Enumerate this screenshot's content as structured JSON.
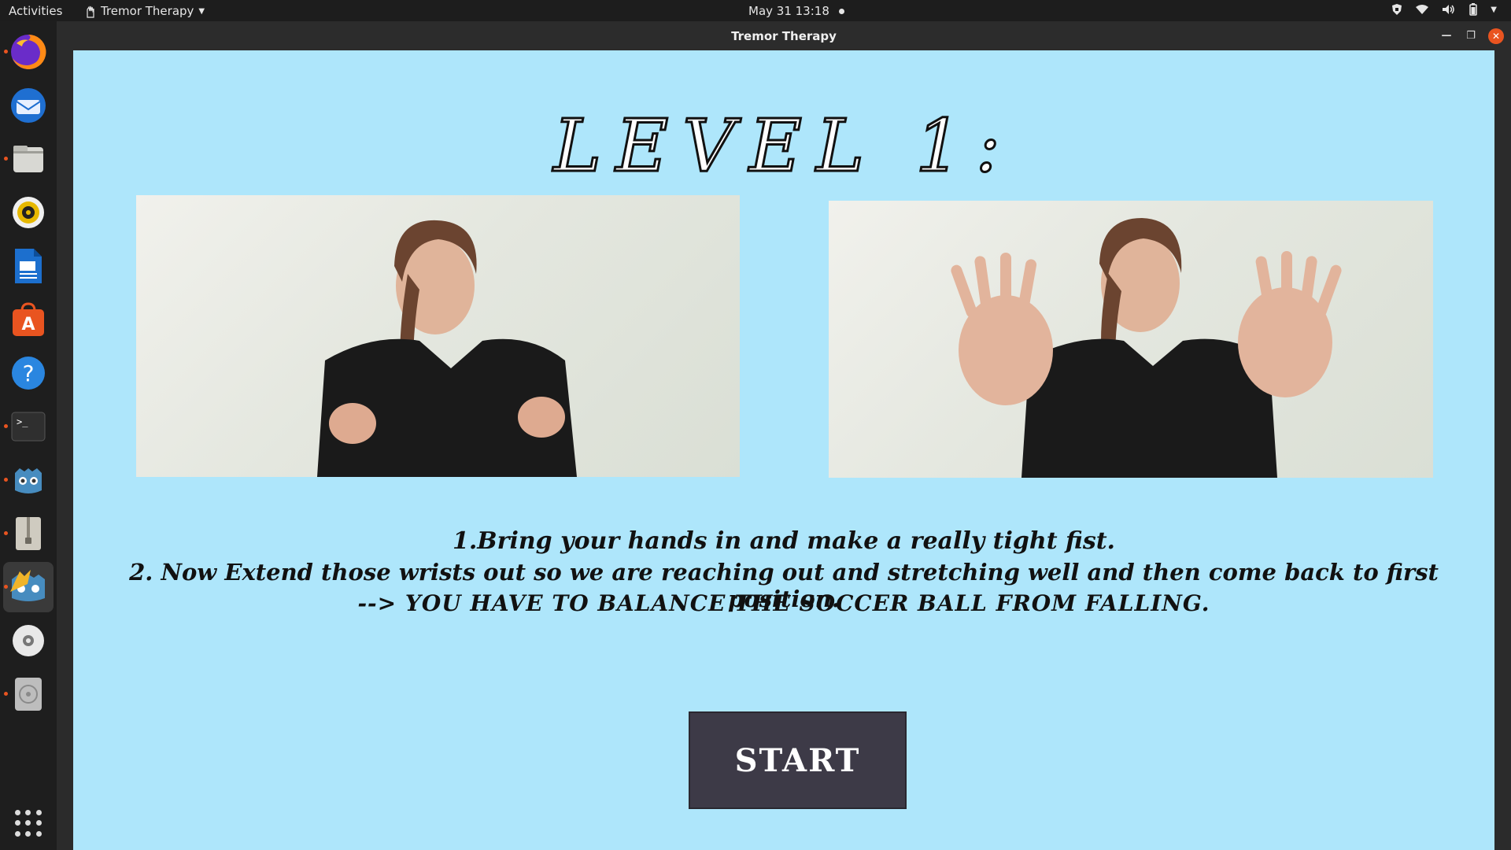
{
  "topbar": {
    "activities": "Activities",
    "app_name": "Tremor Therapy",
    "clock": "May 31  13:18"
  },
  "dock": {
    "items": [
      "firefox",
      "thunderbird",
      "files",
      "rhythmbox",
      "libreoffice-writer",
      "app-center",
      "help",
      "terminal",
      "godot",
      "archive-manager",
      "tremor-therapy",
      "dvd",
      "disk"
    ]
  },
  "window": {
    "title": "Tremor Therapy"
  },
  "game": {
    "level_title": "LEVEL 1:",
    "instruction_1": "1.Bring your hands in and make a really tight fist.",
    "instruction_2": "2. Now Extend those wrists out so we are reaching out and stretching well and then come back to first position.",
    "instruction_3": "--> YOU HAVE TO BALANCE THE SOCCER BALL FROM FALLING.",
    "start_label": "START",
    "background_color": "#aee6fb",
    "button_color": "#3d3a47"
  }
}
